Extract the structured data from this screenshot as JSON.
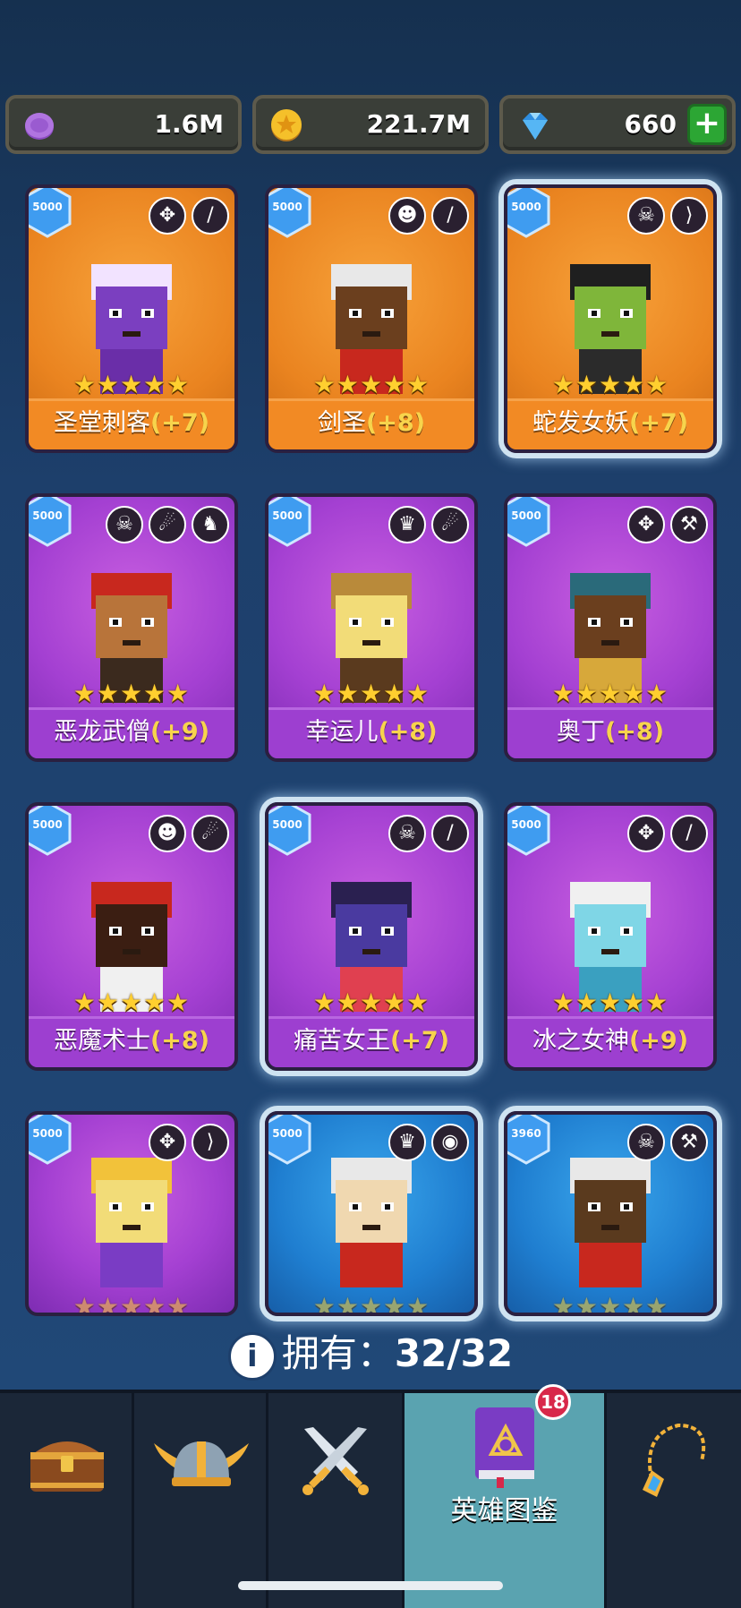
{
  "currencies": [
    {
      "icon": "purple-token-icon",
      "value": "1.6M"
    },
    {
      "icon": "gold-coin-icon",
      "value": "221.7M"
    },
    {
      "icon": "diamond-icon",
      "value": "660",
      "has_plus": true
    }
  ],
  "heroes": [
    {
      "name": "圣堂刺客",
      "plus": "(+7)",
      "badge": "5000",
      "theme": "orange",
      "roles": [
        "wings-icon",
        "dagger-icon"
      ],
      "stars": 5,
      "selected": false
    },
    {
      "name": "剑圣",
      "plus": "(+8)",
      "badge": "5000",
      "theme": "orange",
      "roles": [
        "orc-icon",
        "sword-icon"
      ],
      "stars": 5,
      "selected": false
    },
    {
      "name": "蛇发女妖",
      "plus": "(+7)",
      "badge": "5000",
      "theme": "orange",
      "roles": [
        "skull-icon",
        "bow-icon"
      ],
      "stars": 5,
      "selected": true
    },
    {
      "name": "恶龙武僧",
      "plus": "(+9)",
      "badge": "5000",
      "theme": "purple",
      "roles": [
        "skull-icon",
        "fire-icon",
        "dragon-icon"
      ],
      "stars": 5,
      "selected": false
    },
    {
      "name": "幸运儿",
      "plus": "(+8)",
      "badge": "5000",
      "theme": "purple",
      "roles": [
        "elf-icon",
        "fire-icon"
      ],
      "stars": 5,
      "selected": false
    },
    {
      "name": "奥丁",
      "plus": "(+8)",
      "badge": "5000",
      "theme": "purple",
      "roles": [
        "wings-icon",
        "hammer-icon"
      ],
      "stars": 5,
      "selected": false
    },
    {
      "name": "恶魔术士",
      "plus": "(+8)",
      "badge": "5000",
      "theme": "purple",
      "roles": [
        "orc-icon",
        "fire-icon"
      ],
      "stars": 5,
      "selected": false
    },
    {
      "name": "痛苦女王",
      "plus": "(+7)",
      "badge": "5000",
      "theme": "purple",
      "roles": [
        "skull-icon",
        "staff-icon"
      ],
      "stars": 5,
      "selected": true
    },
    {
      "name": "冰之女神",
      "plus": "(+9)",
      "badge": "5000",
      "theme": "purple",
      "roles": [
        "wings-icon",
        "staff-icon"
      ],
      "stars": 5,
      "selected": false
    },
    {
      "name": "",
      "plus": "",
      "badge": "5000",
      "theme": "purple",
      "roles": [
        "wings-icon",
        "bow-icon"
      ],
      "stars": 5,
      "selected": false
    },
    {
      "name": "",
      "plus": "",
      "badge": "5000",
      "theme": "blue",
      "roles": [
        "elf-icon",
        "eye-icon"
      ],
      "stars": 5,
      "selected": true
    },
    {
      "name": "",
      "plus": "",
      "badge": "3960",
      "theme": "blue",
      "roles": [
        "skull-icon",
        "hammer-icon"
      ],
      "stars": 5,
      "selected": true
    }
  ],
  "collection": {
    "label": "拥有：",
    "count": "32/32"
  },
  "nav": {
    "tabs": [
      {
        "icon": "treasure-chest-icon",
        "label": ""
      },
      {
        "icon": "viking-helmet-icon",
        "label": ""
      },
      {
        "icon": "crossed-swords-icon",
        "label": ""
      },
      {
        "icon": "hero-book-icon",
        "label": "英雄图鉴",
        "active": true,
        "badge": "18"
      },
      {
        "icon": "amulet-icon",
        "label": ""
      }
    ]
  }
}
